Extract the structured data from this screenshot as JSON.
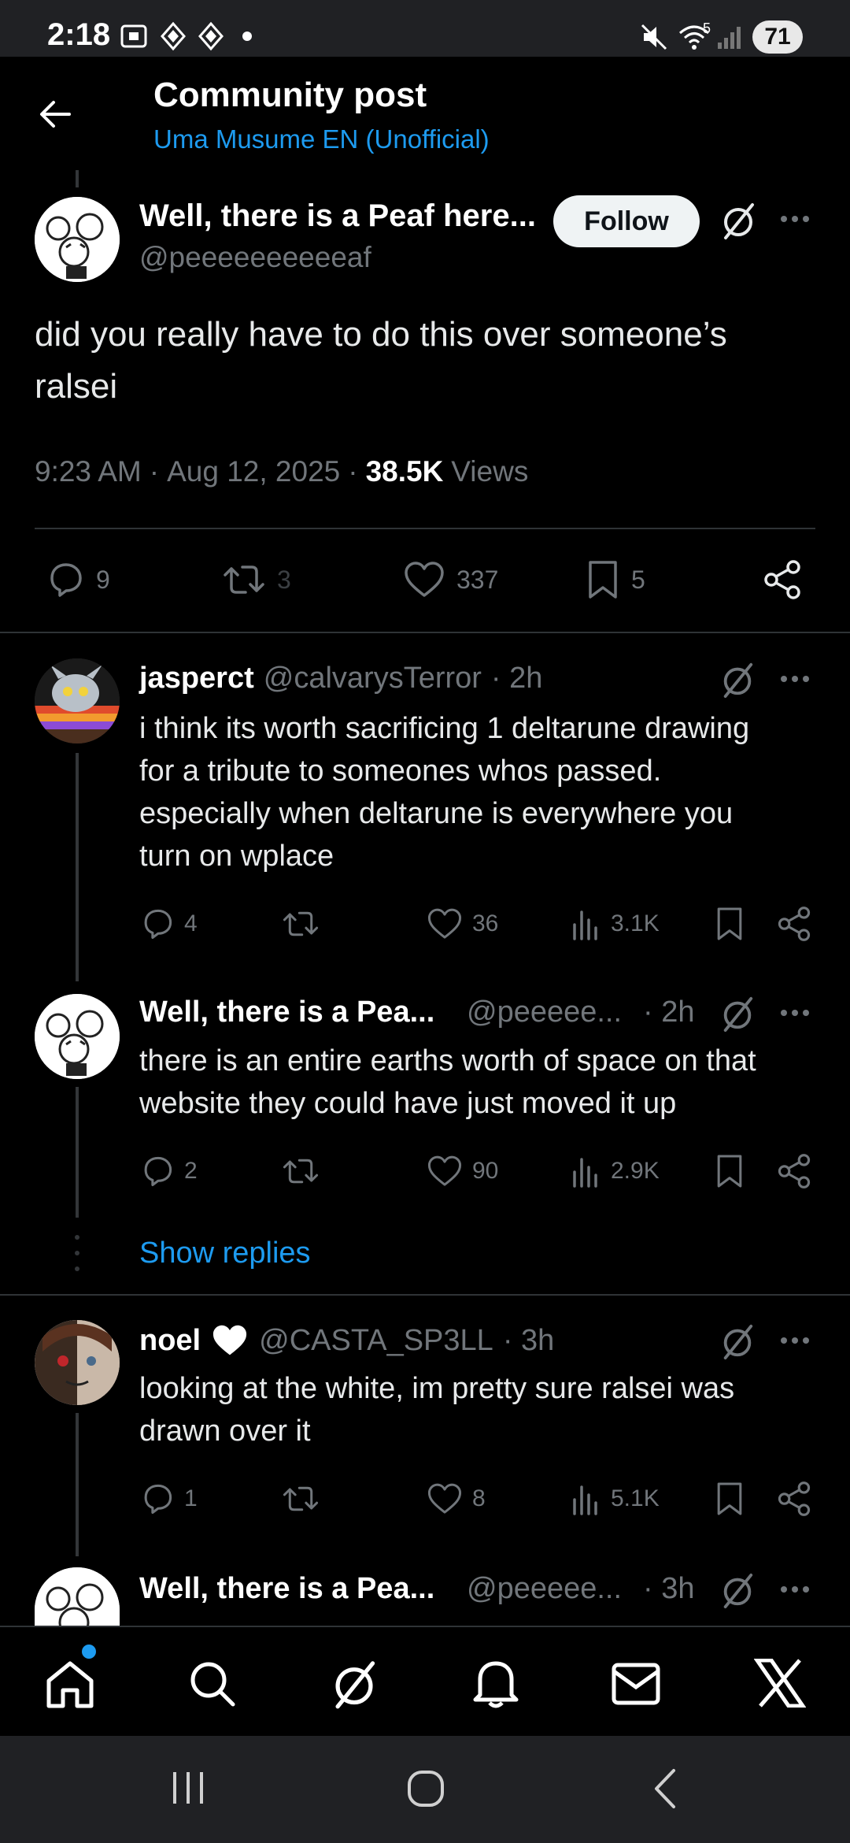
{
  "status_bar": {
    "time": "2:18",
    "battery": "71",
    "network": "5"
  },
  "header": {
    "title": "Community post",
    "subtitle": "Uma Musume EN (Unofficial)"
  },
  "post": {
    "author_name": "Well, there is a Peaf here...",
    "author_handle": "@peeeeeeeeeeaf",
    "follow_label": "Follow",
    "text_line1": "did you really have to do this over someone’s",
    "text_line2": "ralsei",
    "time": "9:23 AM",
    "date": "Aug 12, 2025",
    "views": "38.5K",
    "views_label": "Views",
    "sep": "·",
    "replies": "9",
    "reposts": "3",
    "likes": "337",
    "bookmarks": "5"
  },
  "replies": [
    {
      "name": "jasperct",
      "handle": "@calvarysTerror",
      "time": "· 2h",
      "lines": [
        "i think its worth sacrificing 1 deltarune drawing",
        "for a tribute to someones whos passed.",
        "especially when deltarune is everywhere you",
        "turn on wplace"
      ],
      "replies": "4",
      "reposts": "",
      "likes": "36",
      "views": "3.1K"
    },
    {
      "name": "Well, there is a Pea...",
      "handle": "@peeeee...",
      "time": "· 2h",
      "lines": [
        "there is an entire earths worth of space on that",
        "website they could have just moved it up"
      ],
      "replies": "2",
      "reposts": "",
      "likes": "90",
      "views": "2.9K"
    },
    {
      "name": "noel",
      "handle": "@CASTA_SP3LL",
      "time": "· 3h",
      "lines": [
        "looking at the white, im pretty sure ralsei was",
        "drawn over it"
      ],
      "replies": "1",
      "reposts": "",
      "likes": "8",
      "views": "5.1K"
    },
    {
      "name": "Well, there is a Pea...",
      "handle": "@peeeee...",
      "time": "· 3h"
    }
  ],
  "show_replies_label": "Show replies",
  "colors": {
    "accent": "#1d9bf0",
    "background": "#000000",
    "muted": "#71767b",
    "divider": "#2f3336"
  },
  "icons": [
    "back-arrow-icon",
    "grok-icon",
    "more-icon",
    "reply-icon",
    "repost-icon",
    "like-icon",
    "bookmark-icon",
    "share-icon",
    "views-icon",
    "home-icon",
    "search-icon",
    "notifications-icon",
    "messages-icon",
    "x-logo-icon"
  ]
}
